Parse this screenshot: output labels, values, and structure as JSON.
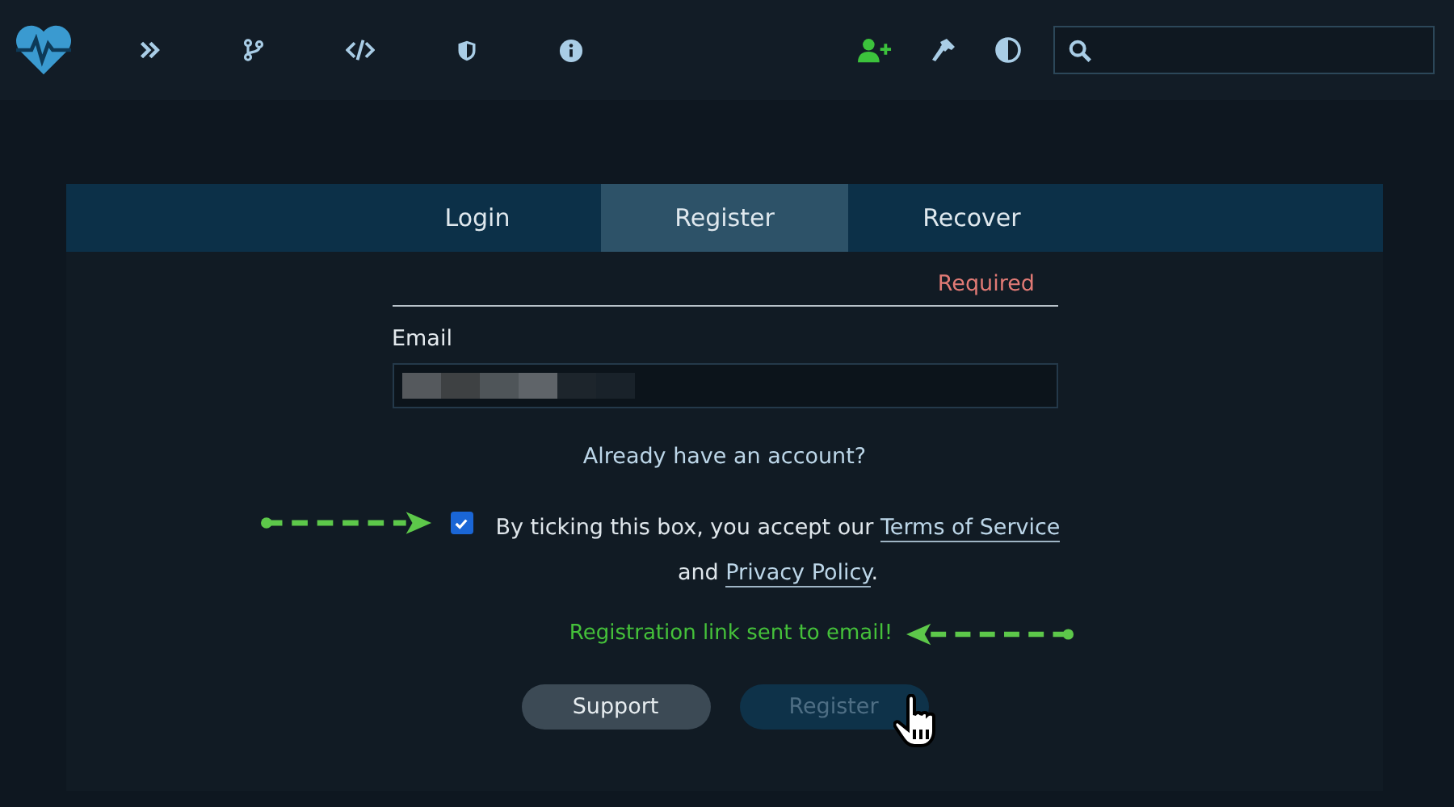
{
  "tabs": [
    {
      "label": "Login",
      "selected": false
    },
    {
      "label": "Register",
      "selected": true
    },
    {
      "label": "Recover",
      "selected": false
    }
  ],
  "form": {
    "required_label": "Required",
    "email": {
      "label": "Email",
      "redacted": true
    },
    "account_link": "Already have an account?",
    "terms": {
      "checked": true,
      "text_before": "By ticking this box, you accept our",
      "terms_link": "Terms of Service",
      "and": "and",
      "privacy_link": "Privacy Policy",
      "end": "."
    },
    "success_message": "Registration link sent to email!"
  },
  "buttons": [
    {
      "label": "Support",
      "disabled": false
    },
    {
      "label": "Register",
      "disabled": true
    }
  ]
}
